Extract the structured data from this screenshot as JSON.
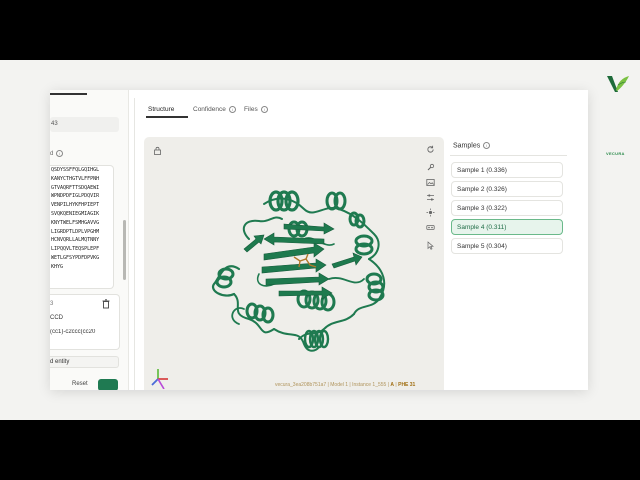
{
  "brand": {
    "name": "VECURA",
    "color_dark": "#1e6b3a",
    "color_light": "#7ac142"
  },
  "left_panel": {
    "field_value": "43",
    "section_label": "d",
    "sequence_lines": [
      "QSDYSSFFQLGQIHGL",
      "KANYCTHGTVLFFPNH",
      "GTVAQRFTTSDQAEWI",
      "WPNDPDFIGLPDQVIR",
      "VENPILHYKFHPIEPT",
      "SVQKQENIEGMIAGIK",
      "KNYTWELFSMHGAVVG",
      "LIGRDPTLDPLVPGHM",
      "HCNVQRLLALMQTNNY",
      "LIPQQVLTEQSPLEPF",
      "WETLGFSYPDFDPVKG",
      "KHYG"
    ],
    "ligand": {
      "title": "3",
      "source_label": "CCD",
      "smiles": "(cc1)-c2ccc(cc20"
    },
    "add_entity_label": "d entity",
    "reset_label": "Reset"
  },
  "tabs": [
    {
      "label": "Structure",
      "active": true
    },
    {
      "label": "Confidence",
      "active": false
    },
    {
      "label": "Files",
      "active": false
    }
  ],
  "viewer": {
    "background": "#efeeea",
    "protein_color": "#1f7a50",
    "ligand_color": "#b0792a",
    "icons": [
      "lock-icon",
      "rotate-icon",
      "wrench-icon",
      "image-icon",
      "sliders-icon",
      "sun-icon",
      "vr-icon",
      "cursor-icon"
    ],
    "status": {
      "entry": "vecura_3ea208b751a7",
      "model": "Model 1",
      "instance": "Instance 1_555",
      "chain": "A",
      "residue": "PHE 31"
    }
  },
  "samples": {
    "title": "Samples",
    "items": [
      {
        "label": "Sample 1 (0.336)",
        "selected": false
      },
      {
        "label": "Sample 2 (0.326)",
        "selected": false
      },
      {
        "label": "Sample 3 (0.322)",
        "selected": false
      },
      {
        "label": "Sample 4 (0.311)",
        "selected": true
      },
      {
        "label": "Sample 5 (0.304)",
        "selected": false
      }
    ]
  }
}
